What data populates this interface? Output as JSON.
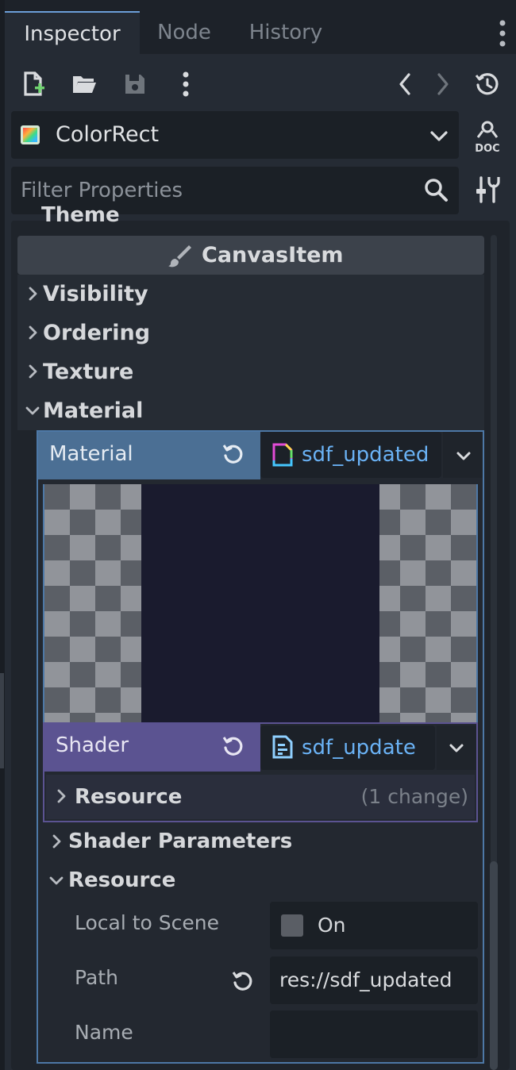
{
  "tabs": [
    {
      "label": "Inspector",
      "active": true
    },
    {
      "label": "Node",
      "active": false
    },
    {
      "label": "History",
      "active": false
    }
  ],
  "toolbar": {
    "icons": [
      "new-resource-icon",
      "open-resource-icon",
      "save-resource-icon",
      "more-options-icon",
      "back-icon",
      "forward-icon",
      "history-icon"
    ]
  },
  "object_selector": {
    "name": "ColorRect",
    "icon": "color-rect-icon"
  },
  "doc_button": {
    "icon": "doc-icon"
  },
  "filter": {
    "placeholder": "Filter Properties",
    "icon": "search-icon"
  },
  "inspector": {
    "partial_section": "Theme",
    "category": "CanvasItem",
    "sections": [
      {
        "label": "Visibility",
        "expanded": false
      },
      {
        "label": "Ordering",
        "expanded": false
      },
      {
        "label": "Texture",
        "expanded": false
      },
      {
        "label": "Material",
        "expanded": true
      }
    ],
    "material": {
      "label": "Material",
      "resource_name": "sdf_updated",
      "shader": {
        "label": "Shader",
        "resource_name": "sdf_update",
        "resource_section": {
          "label": "Resource",
          "changes": "(1 change)"
        }
      },
      "subsections": [
        {
          "label": "Shader Parameters",
          "expanded": false
        },
        {
          "label": "Resource",
          "expanded": true
        }
      ],
      "resource_properties": {
        "local_to_scene": {
          "label": "Local to Scene",
          "value_label": "On",
          "checked": false
        },
        "path": {
          "label": "Path",
          "value": "res://sdf_updated"
        },
        "name": {
          "label": "Name",
          "value": ""
        }
      }
    }
  },
  "colors": {
    "accent": "#6c9ed8",
    "material_row": "#4b6f94",
    "shader_row": "#5b5391",
    "resource_link": "#6ab2f5",
    "panel_bg": "#252b34"
  }
}
